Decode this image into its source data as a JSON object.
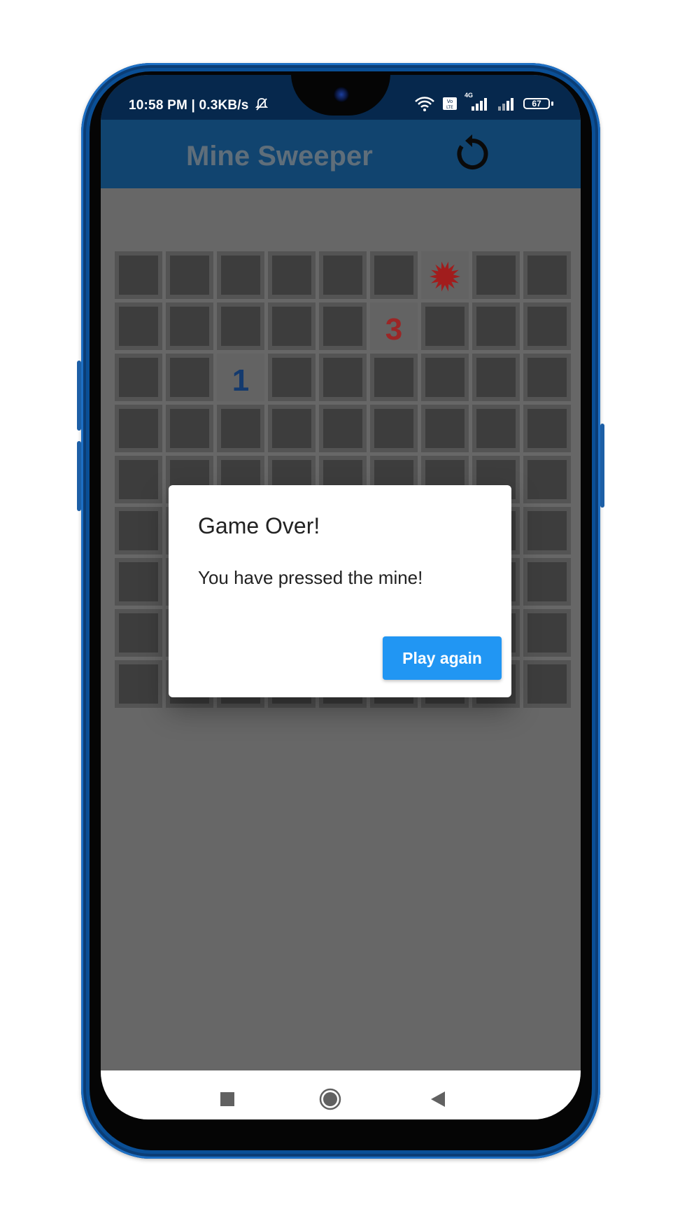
{
  "status_bar": {
    "left_text": "10:58 PM | 0.3KB/s",
    "battery": "67",
    "network": "4G"
  },
  "app_bar": {
    "title": "Mine Sweeper",
    "refresh_icon": "refresh-icon"
  },
  "board": {
    "rows": 9,
    "cols": 9,
    "revealed": [
      {
        "row": 0,
        "col": 6,
        "type": "mine",
        "icon": "mine-icon",
        "color": "#a11d1d"
      },
      {
        "row": 1,
        "col": 5,
        "type": "number",
        "value": "3",
        "color": "#9b2626"
      },
      {
        "row": 2,
        "col": 2,
        "type": "number",
        "value": "1",
        "color": "#143a6e"
      }
    ]
  },
  "dialog": {
    "title": "Game Over!",
    "message": "You have pressed the mine!",
    "button_label": "Play again"
  },
  "nav_bar": {
    "items": [
      "recents-icon",
      "home-icon",
      "back-icon"
    ]
  },
  "colors": {
    "app_bar": "#11446f",
    "status_bar": "#06284d",
    "button": "#2196f3",
    "overlay_bg": "#676767"
  }
}
